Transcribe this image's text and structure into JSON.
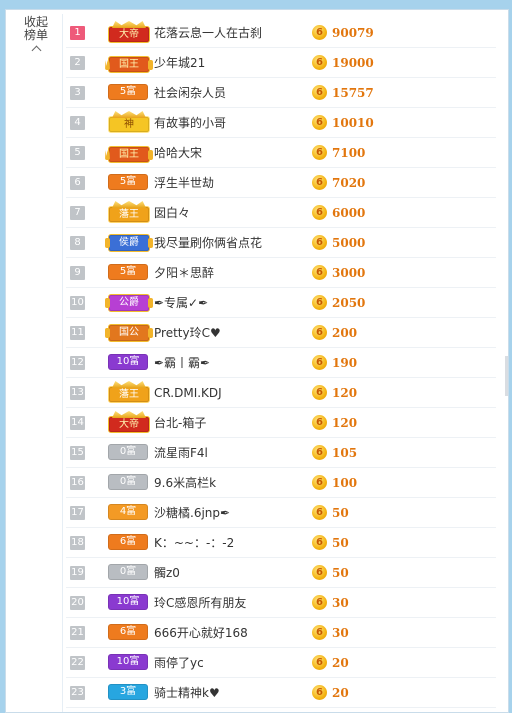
{
  "sidebar": {
    "collapse_label": "收起榜单"
  },
  "rows": [
    {
      "rank": "1",
      "badge": "大帝",
      "badge_type": "dadi",
      "name": "花落云息一人在古刹",
      "score": "90079"
    },
    {
      "rank": "2",
      "badge": "国王",
      "badge_type": "guowang",
      "name": "少年城21",
      "score": "19000"
    },
    {
      "rank": "3",
      "badge": "5富",
      "badge_type": "5",
      "name": "社会闲杂人员",
      "score": "15757"
    },
    {
      "rank": "4",
      "badge": "神",
      "badge_type": "shen",
      "name": "有故事的小哥",
      "score": "10010"
    },
    {
      "rank": "5",
      "badge": "国王",
      "badge_type": "guowang",
      "name": "哈哈大宋",
      "score": "7100"
    },
    {
      "rank": "6",
      "badge": "5富",
      "badge_type": "5",
      "name": "浮生半世劫",
      "score": "7020"
    },
    {
      "rank": "7",
      "badge": "藩王",
      "badge_type": "fanwang",
      "name": "囡白々",
      "score": "6000"
    },
    {
      "rank": "8",
      "badge": "侯爵",
      "badge_type": "houjue",
      "name": "我尽量刷你俩省点花",
      "score": "5000"
    },
    {
      "rank": "9",
      "badge": "5富",
      "badge_type": "5",
      "name": "夕阳＊思醉",
      "score": "3000"
    },
    {
      "rank": "10",
      "badge": "公爵",
      "badge_type": "gongjue",
      "name": "✒专属✓✒",
      "score": "2050"
    },
    {
      "rank": "11",
      "badge": "国公",
      "badge_type": "guogong",
      "name": "Pretty玲C♥",
      "score": "200"
    },
    {
      "rank": "12",
      "badge": "10富",
      "badge_type": "10",
      "name": "✒霸丨霸✒",
      "score": "190"
    },
    {
      "rank": "13",
      "badge": "藩王",
      "badge_type": "fanwang",
      "name": "CR.DMI.KDJ",
      "score": "120"
    },
    {
      "rank": "14",
      "badge": "大帝",
      "badge_type": "dadi",
      "name": "台北-箱子",
      "score": "120"
    },
    {
      "rank": "15",
      "badge": "0富",
      "badge_type": "0",
      "name": "流星雨F4l",
      "score": "105"
    },
    {
      "rank": "16",
      "badge": "0富",
      "badge_type": "0",
      "name": "9.6米高栏k",
      "score": "100"
    },
    {
      "rank": "17",
      "badge": "4富",
      "badge_type": "4",
      "name": "沙糖橘.6jnp✒",
      "score": "50"
    },
    {
      "rank": "18",
      "badge": "6富",
      "badge_type": "6",
      "name": "K：~~：-：-2",
      "score": "50"
    },
    {
      "rank": "19",
      "badge": "0富",
      "badge_type": "0",
      "name": "髑z0",
      "score": "50"
    },
    {
      "rank": "20",
      "badge": "10富",
      "badge_type": "10",
      "name": "玲C感恩所有朋友",
      "score": "30"
    },
    {
      "rank": "21",
      "badge": "6富",
      "badge_type": "6",
      "name": "666开心就好168",
      "score": "30"
    },
    {
      "rank": "22",
      "badge": "10富",
      "badge_type": "10",
      "name": "雨停了yc",
      "score": "20"
    },
    {
      "rank": "23",
      "badge": "3富",
      "badge_type": "3",
      "name": "骑士精神k♥",
      "score": "20"
    }
  ],
  "coin_glyph": "6",
  "colors": {
    "background": "#a6d2ec",
    "score": "#e2760d",
    "rank_first": "#ee5a7a"
  }
}
